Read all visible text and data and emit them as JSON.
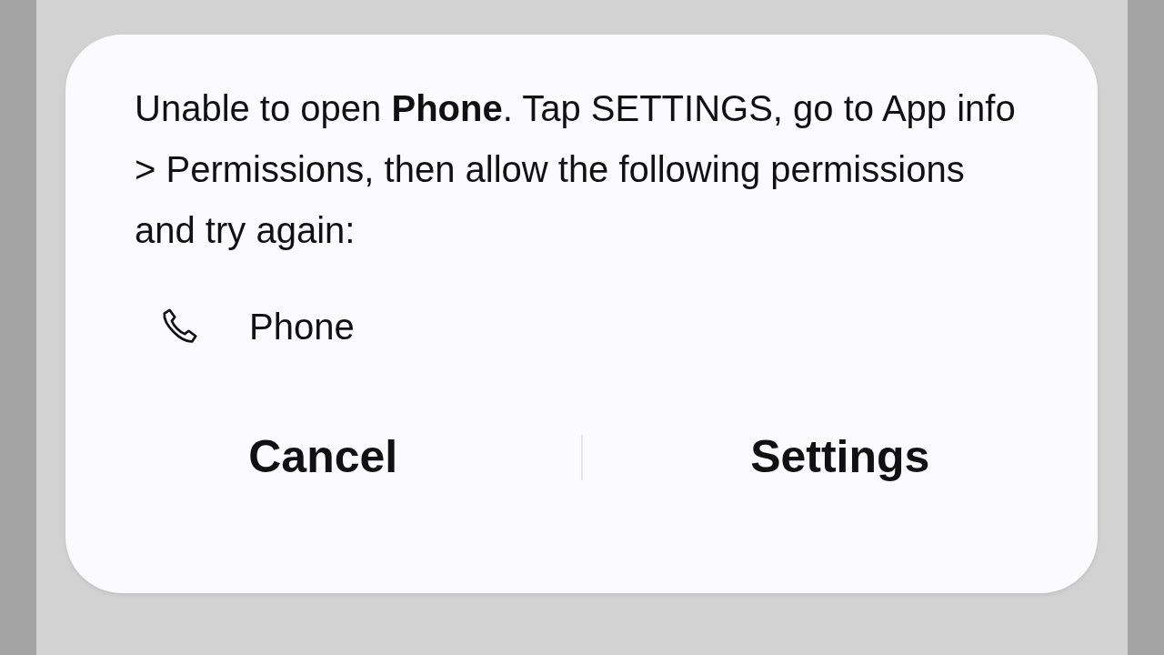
{
  "dialog": {
    "message": "Unable to open **Phone**. Tap SETTINGS, go to App info > Permissions, then allow the following permissions and try again:",
    "permissions": [
      {
        "label": "Phone",
        "kind": "phone"
      }
    ],
    "buttons": [
      "Cancel",
      "Settings"
    ]
  }
}
